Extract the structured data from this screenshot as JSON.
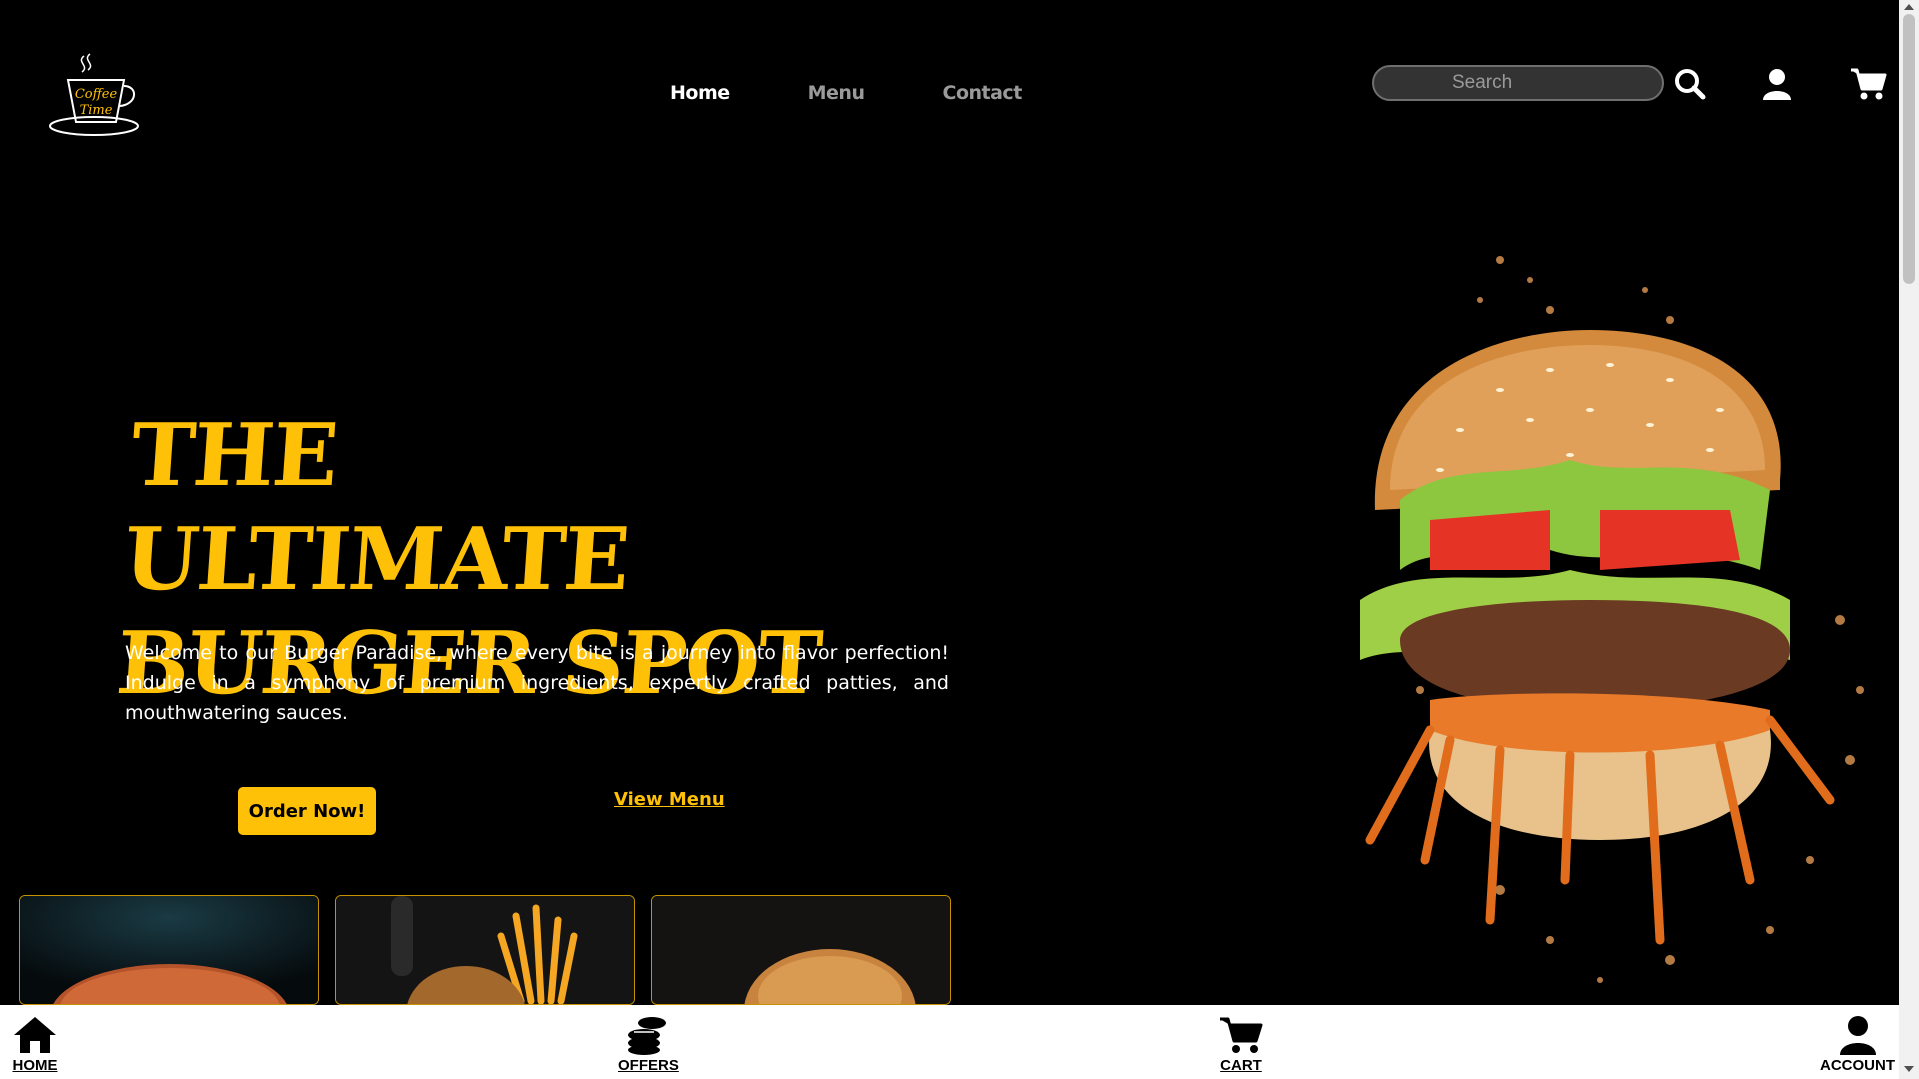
{
  "header": {
    "logo_text": "Coffee Time",
    "nav": [
      {
        "label": "Home",
        "active": true
      },
      {
        "label": "Menu",
        "active": false
      },
      {
        "label": "Contact",
        "active": false
      }
    ],
    "search_placeholder": "Search",
    "icons": [
      "search-icon",
      "user-icon",
      "cart-icon"
    ]
  },
  "hero": {
    "headline_line1": "THE ULTIMATE",
    "headline_line2": "BURGER SPOT",
    "intro": "Welcome to our Burger Paradise, where every bite is a journey into flavor perfection! Indulge in a symphony of premium ingredients, expertly crafted patties, and mouthwatering sauces.",
    "order_button": "Order Now!",
    "view_menu_link": "View Menu"
  },
  "bottom_nav": [
    {
      "label": "HOME",
      "icon": "home-icon"
    },
    {
      "label": "OFFERS",
      "icon": "coins-icon"
    },
    {
      "label": "CART",
      "icon": "cart-icon"
    },
    {
      "label": "ACCOUNT",
      "icon": "account-icon"
    }
  ],
  "colors": {
    "accent": "#ffc107",
    "background": "#000000",
    "nav_inactive": "#9a9a9a"
  }
}
